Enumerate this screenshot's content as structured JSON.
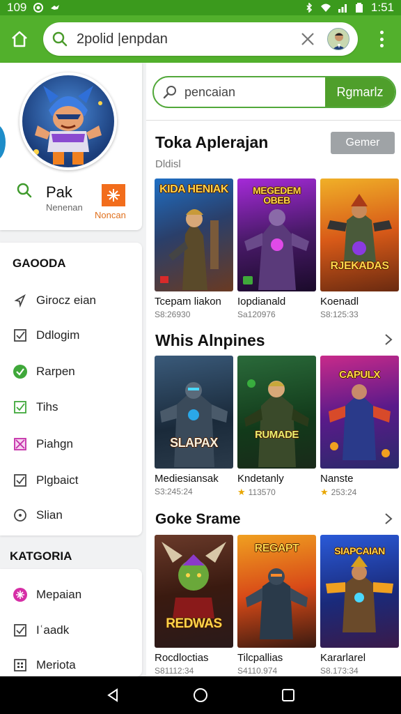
{
  "status_bar": {
    "left_text": "109",
    "time": "1:51"
  },
  "app_bar": {
    "search_query": "2polid |enpdan"
  },
  "profile": {
    "name": "Pak",
    "subtitle": "Nenenan",
    "badge_label": "Noncan"
  },
  "left_section_1": {
    "title": "GAOODA",
    "items": [
      {
        "label": "Girocz eian",
        "icon": "send-icon"
      },
      {
        "label": "Ddlogim",
        "icon": "checkbox-icon"
      },
      {
        "label": "Rarpen",
        "icon": "verified-icon"
      },
      {
        "label": "Tihs",
        "icon": "checkbox-green-icon"
      },
      {
        "label": "Piahgn",
        "icon": "crossed-box-icon"
      },
      {
        "label": "Plgbaict",
        "icon": "checkbox-icon"
      },
      {
        "label": "Slian",
        "icon": "radio-icon"
      }
    ]
  },
  "left_section_2": {
    "title": "KATGORIA",
    "items": [
      {
        "label": "Mepaian",
        "icon": "magenta-badge-icon"
      },
      {
        "label": "Iʿaadk",
        "icon": "checkbox-icon"
      },
      {
        "label": "Meriota",
        "icon": "grid-icon"
      }
    ]
  },
  "main": {
    "search": {
      "placeholder": "pencaian",
      "button": "Rgmarlz"
    },
    "section_1": {
      "title": "Toka Aplerajan",
      "subtitle": "Dldisl",
      "button": "Gemer",
      "games": [
        {
          "title_art": "KIDA HENIAK",
          "name": "Tcepam liakon",
          "meta": "S8:26930"
        },
        {
          "title_art": "MEGEDEM OBEB",
          "name": "Iopdianald",
          "meta": "Sa120976"
        },
        {
          "title_art": "RJEKADAS",
          "name": "Koenadl",
          "meta": "S8:125:33"
        }
      ]
    },
    "section_2": {
      "title": "Whis Alnpines",
      "games": [
        {
          "title_art": "SLAPAX",
          "name": "Mediesiansak",
          "meta": "S3:245:24",
          "star": false
        },
        {
          "title_art": "RUMADE",
          "name": "Kndetanly",
          "meta": "113570",
          "star": true
        },
        {
          "title_art": "CAPULX",
          "name": "Nanste",
          "meta": "253:24",
          "star": true
        }
      ]
    },
    "section_3": {
      "title": "Goke Srame",
      "games": [
        {
          "title_art": "REDWAS",
          "name": "Rocdloctias",
          "meta": "S81112:34"
        },
        {
          "title_art": "REGAPT",
          "name": "Tilcpallias",
          "meta": "S4110.974"
        },
        {
          "title_art": "SIAPCAIAN",
          "name": "Kararlarel",
          "meta": "S8.173:34"
        }
      ]
    }
  },
  "colors": {
    "brand_green": "#52b02c",
    "status_green": "#3b9a1d",
    "button_grey": "#9fa3a6",
    "accent_orange": "#f26d1c"
  }
}
